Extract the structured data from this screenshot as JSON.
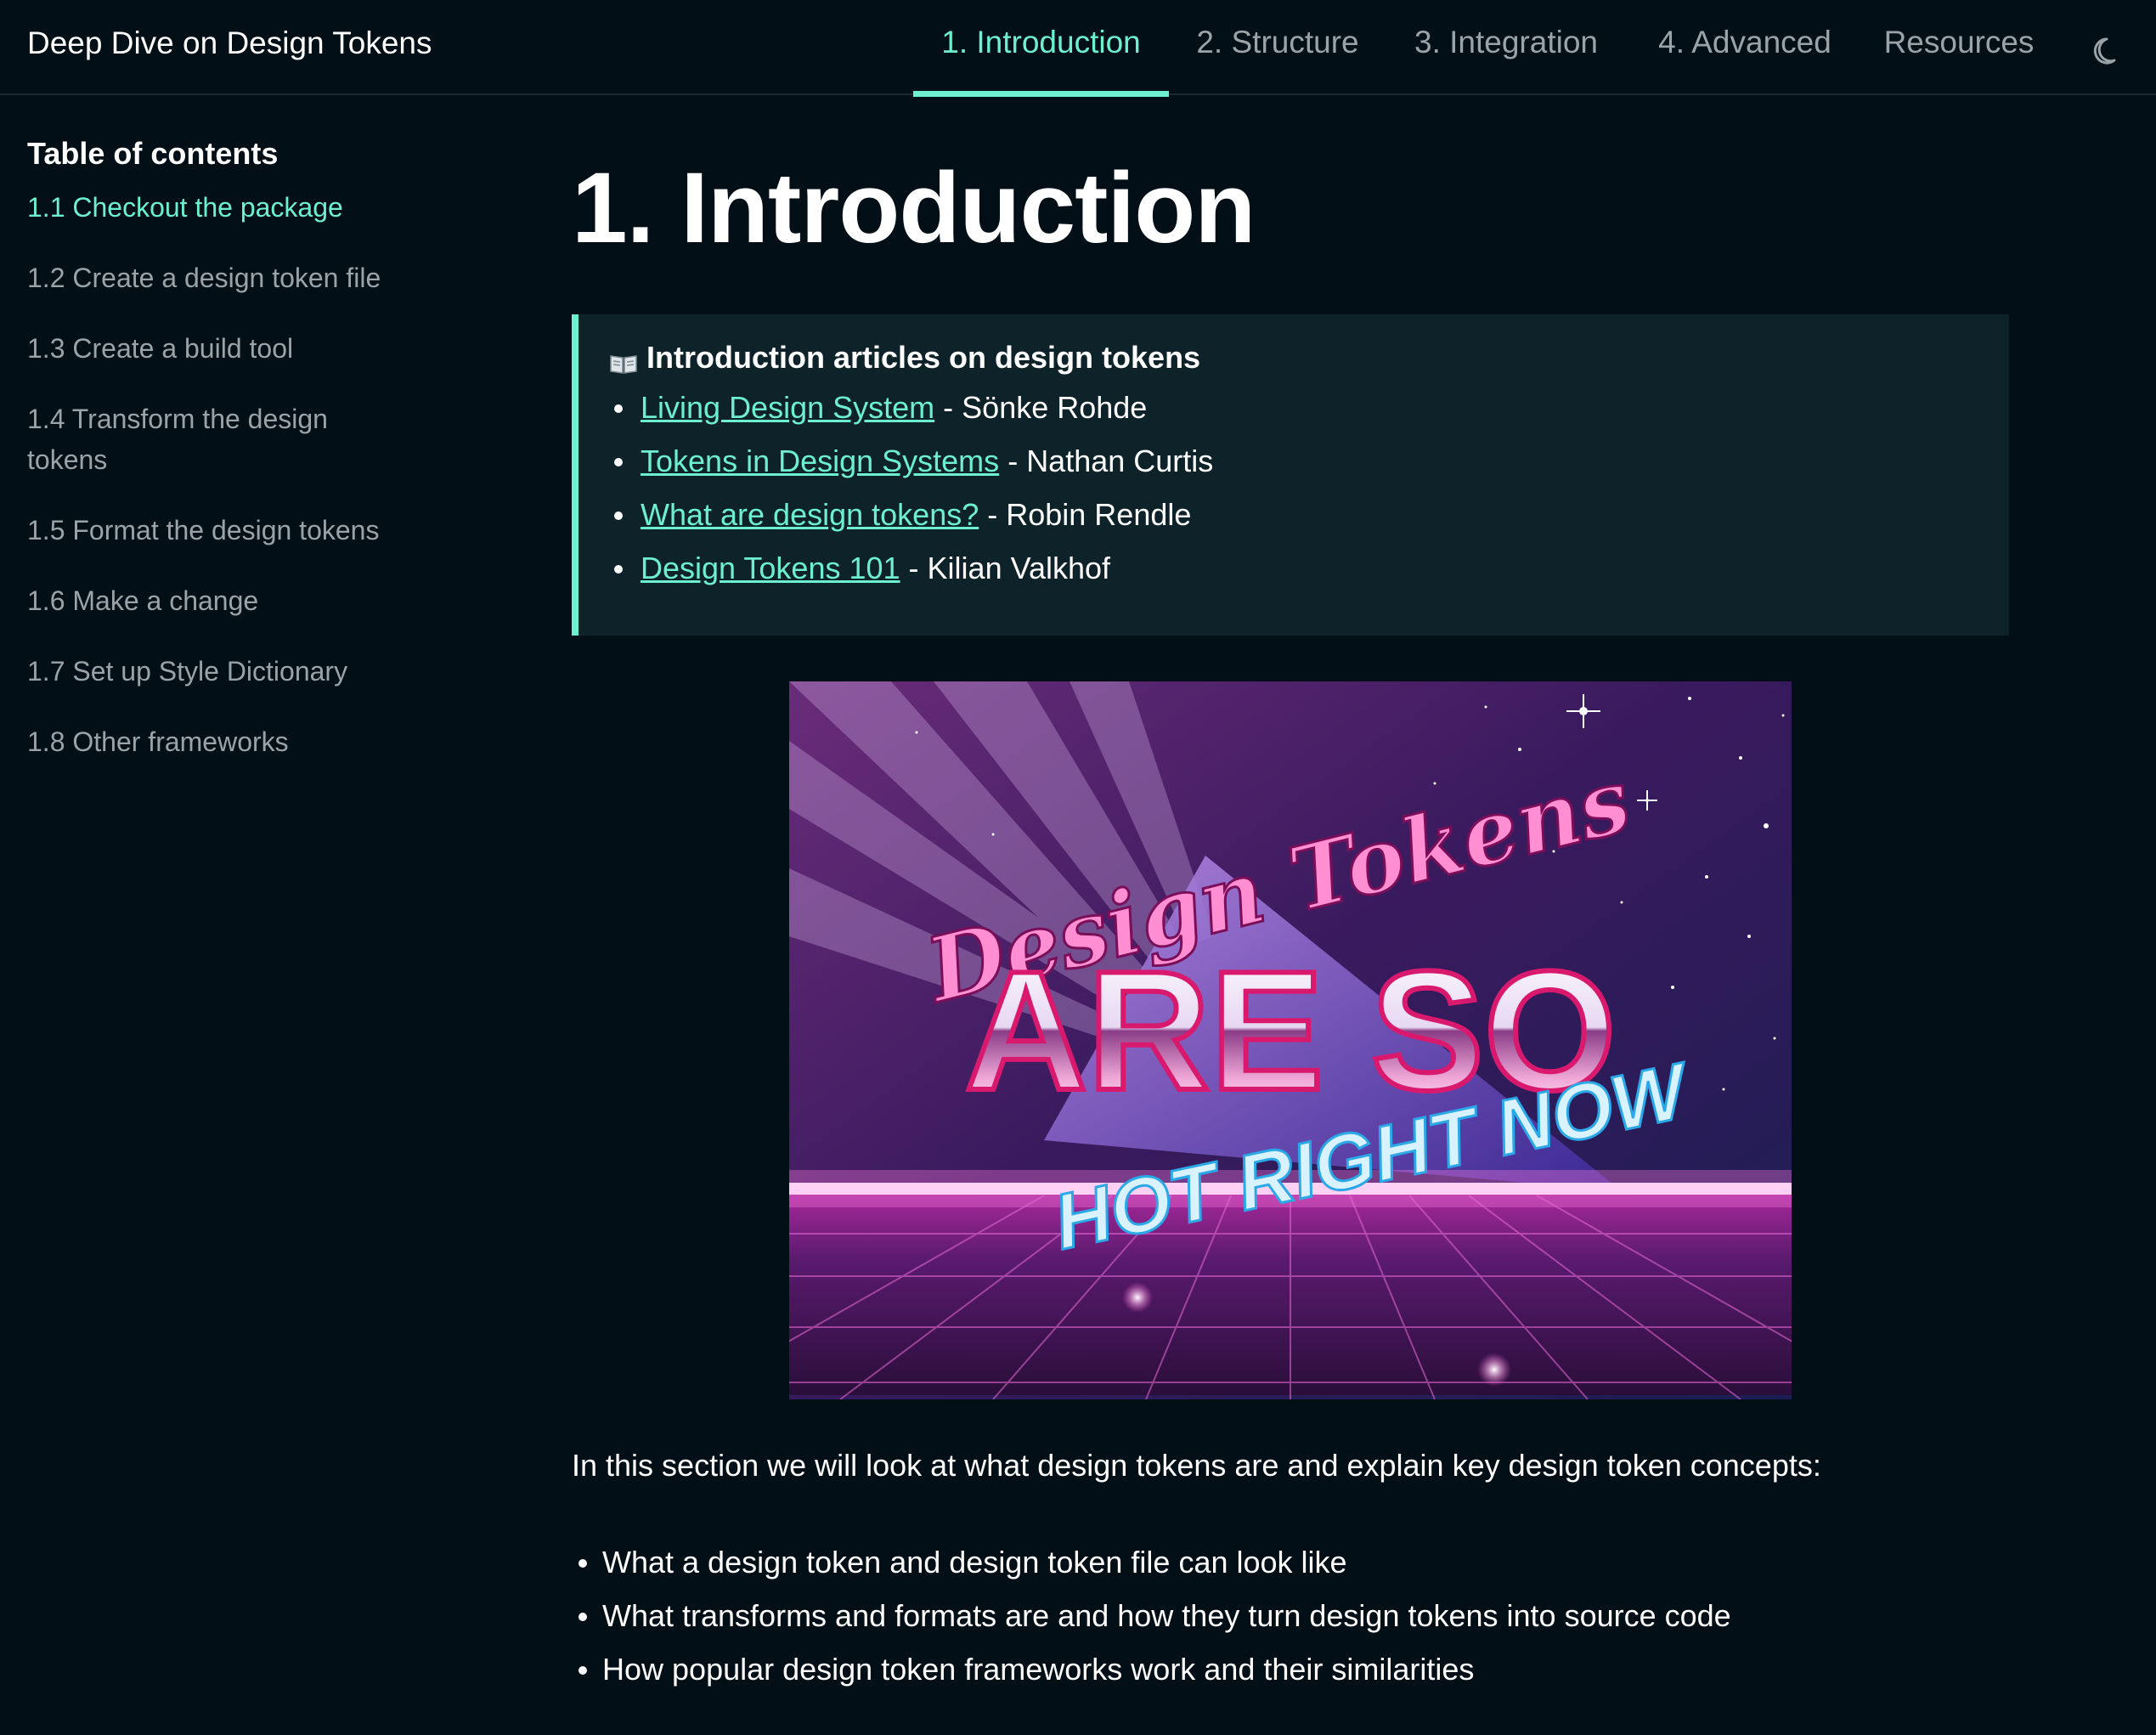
{
  "header": {
    "site_title": "Deep Dive on Design Tokens",
    "tabs": [
      {
        "label": "1. Introduction",
        "active": true
      },
      {
        "label": "2. Structure",
        "active": false
      },
      {
        "label": "3. Integration",
        "active": false
      },
      {
        "label": "4. Advanced",
        "active": false
      },
      {
        "label": "Resources",
        "active": false
      }
    ],
    "theme_toggle_icon": "moon-icon"
  },
  "sidebar": {
    "heading": "Table of contents",
    "items": [
      {
        "label": "1.1 Checkout the package",
        "active": true
      },
      {
        "label": "1.2 Create a design token file",
        "active": false
      },
      {
        "label": "1.3 Create a build tool",
        "active": false
      },
      {
        "label": "1.4 Transform the design tokens",
        "active": false
      },
      {
        "label": "1.5 Format the design tokens",
        "active": false
      },
      {
        "label": "1.6 Make a change",
        "active": false
      },
      {
        "label": "1.7 Set up Style Dictionary",
        "active": false
      },
      {
        "label": "1.8 Other frameworks",
        "active": false
      }
    ]
  },
  "main": {
    "title": "1. Introduction",
    "callout": {
      "icon": "book-icon",
      "title": "Introduction articles on design tokens",
      "articles": [
        {
          "link": "Living Design System",
          "author": "Sönke Rohde"
        },
        {
          "link": "Tokens in Design Systems",
          "author": "Nathan Curtis"
        },
        {
          "link": "What are design tokens?",
          "author": "Robin Rendle"
        },
        {
          "link": "Design Tokens 101",
          "author": "Kilian Valkhof"
        }
      ]
    },
    "hero_image": {
      "line1": "Design Tokens",
      "line2": "ARE SO",
      "line3": "HOT RIGHT NOW"
    },
    "intro": "In this section we will look at what design tokens are and explain key design token concepts:",
    "concepts": [
      "What a design token and design token file can look like",
      "What transforms and formats are and how they turn design tokens into source code",
      "How popular design token frameworks work and their similarities"
    ]
  },
  "colors": {
    "background": "#020f16",
    "accent": "#6cf0cf",
    "callout_bg": "#0e2229",
    "muted_text": "#9aa3a8"
  }
}
